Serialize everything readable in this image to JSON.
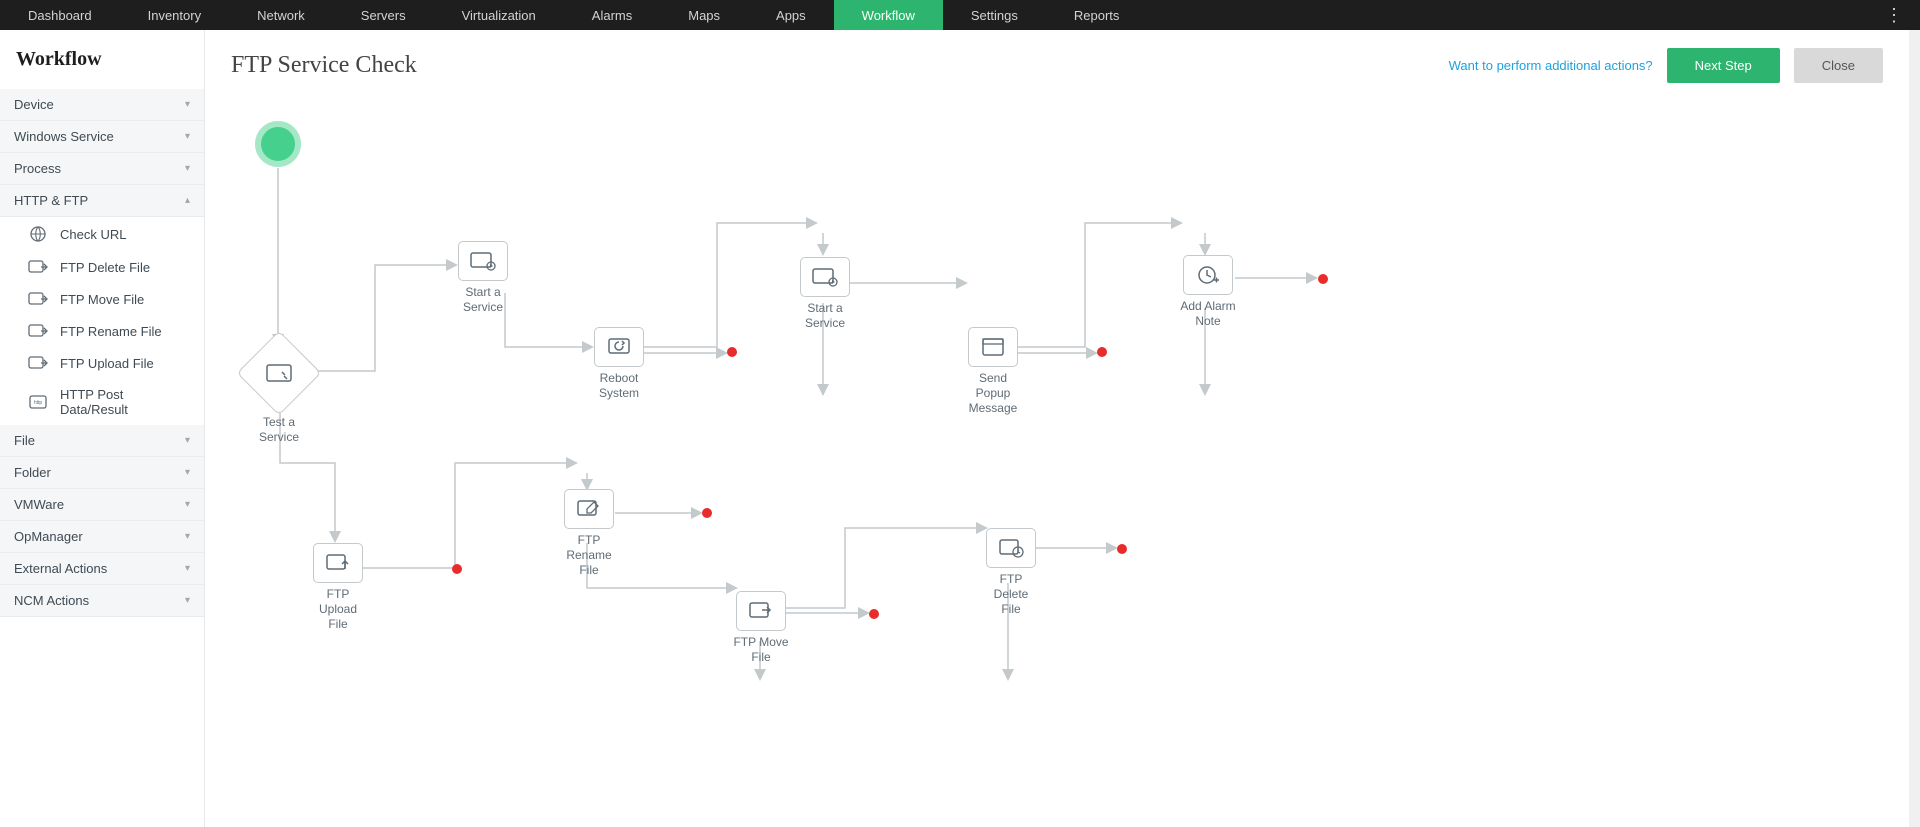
{
  "nav": {
    "items": [
      "Dashboard",
      "Inventory",
      "Network",
      "Servers",
      "Virtualization",
      "Alarms",
      "Maps",
      "Apps",
      "Workflow",
      "Settings",
      "Reports"
    ],
    "active": "Workflow"
  },
  "sidebar": {
    "title": "Workflow",
    "categories": [
      {
        "label": "Device",
        "expanded": false
      },
      {
        "label": "Windows Service",
        "expanded": false
      },
      {
        "label": "Process",
        "expanded": false
      },
      {
        "label": "HTTP & FTP",
        "expanded": true,
        "items": [
          {
            "label": "Check URL",
            "icon": "globe"
          },
          {
            "label": "FTP Delete File",
            "icon": "ftp"
          },
          {
            "label": "FTP Move File",
            "icon": "ftp"
          },
          {
            "label": "FTP Rename File",
            "icon": "ftp"
          },
          {
            "label": "FTP Upload File",
            "icon": "ftp"
          },
          {
            "label": "HTTP Post Data/Result",
            "icon": "httpbox"
          }
        ]
      },
      {
        "label": "File",
        "expanded": false
      },
      {
        "label": "Folder",
        "expanded": false
      },
      {
        "label": "VMWare",
        "expanded": false
      },
      {
        "label": "OpManager",
        "expanded": false
      },
      {
        "label": "External Actions",
        "expanded": false
      },
      {
        "label": "NCM Actions",
        "expanded": false
      }
    ]
  },
  "header": {
    "title": "FTP Service Check",
    "link": "Want to perform additional actions?",
    "next": "Next Step",
    "close": "Close"
  },
  "nodes": {
    "test": "Test a Service",
    "startsvc1": "Start a Service",
    "reboot": "Reboot System",
    "startsvc2": "Start a Service",
    "sendpopup": "Send Popup Message",
    "alarmnote": "Add Alarm Note",
    "ftpupload": "FTP Upload File",
    "ftprename": "FTP Rename File",
    "ftpmove": "FTP Move File",
    "ftpdelete": "FTP Delete File"
  }
}
